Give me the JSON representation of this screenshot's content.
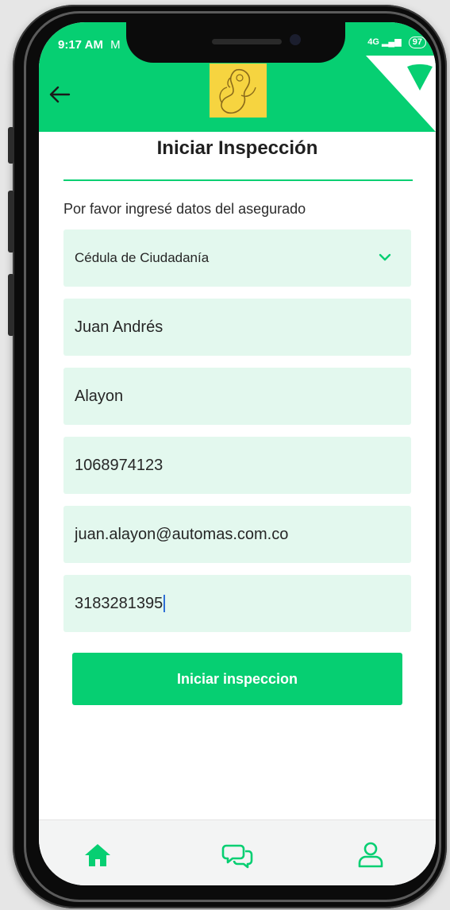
{
  "status_bar": {
    "time": "9:17 AM",
    "mail_icon": "M",
    "network": "4G",
    "battery": "97"
  },
  "header": {
    "back_icon": "arrow-left-icon",
    "logo_icon": "mother-child-logo",
    "corner_icon": "wifi-icon"
  },
  "page": {
    "title": "Iniciar Inspección",
    "prompt": "Por favor ingresé datos del asegurado"
  },
  "form": {
    "document_type": "Cédula de Ciudadanía",
    "first_name": "Juan Andrés",
    "last_name": "Alayon",
    "document_number": "1068974123",
    "email": "juan.alayon@automas.com.co",
    "phone": "3183281395"
  },
  "actions": {
    "start_label": "Iniciar inspeccion"
  },
  "nav": {
    "items": [
      "home-icon",
      "chat-icon",
      "user-icon"
    ]
  },
  "colors": {
    "accent": "#06cf72",
    "field_bg": "#e3f8ee"
  }
}
